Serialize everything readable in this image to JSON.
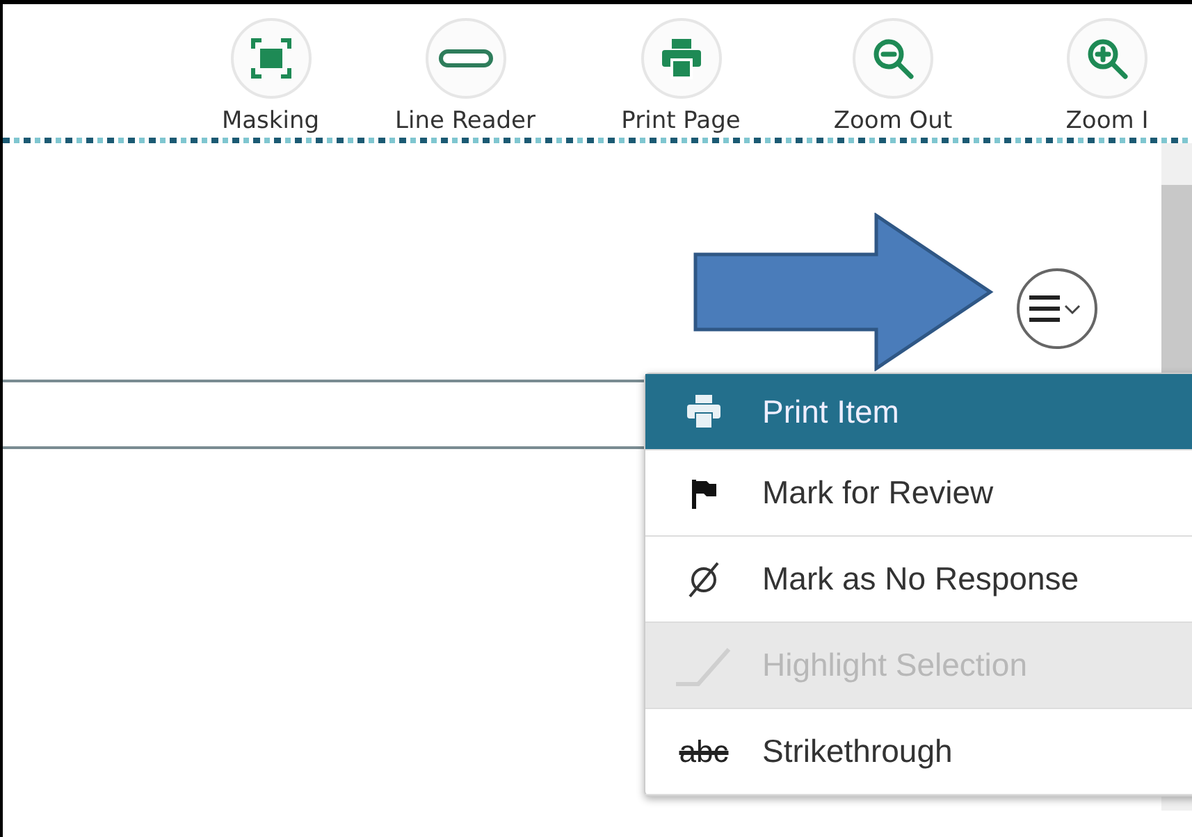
{
  "toolbar": [
    {
      "kind": "masking",
      "label": "Masking"
    },
    {
      "kind": "line-reader",
      "label": "Line Reader"
    },
    {
      "kind": "print",
      "label": "Print Page"
    },
    {
      "kind": "zoom-out",
      "label": "Zoom Out"
    },
    {
      "kind": "zoom-in",
      "label": "Zoom I"
    }
  ],
  "menu": {
    "items": [
      {
        "kind": "print",
        "label": "Print Item",
        "selected": true,
        "disabled": false
      },
      {
        "kind": "flag",
        "label": "Mark for Review",
        "selected": false,
        "disabled": false
      },
      {
        "kind": "no-response",
        "label": "Mark as No Response",
        "selected": false,
        "disabled": false
      },
      {
        "kind": "highlight",
        "label": "Highlight Selection",
        "selected": false,
        "disabled": true
      },
      {
        "kind": "strike",
        "label": "Strikethrough",
        "icon_text": "abc",
        "selected": false,
        "disabled": false
      }
    ]
  }
}
